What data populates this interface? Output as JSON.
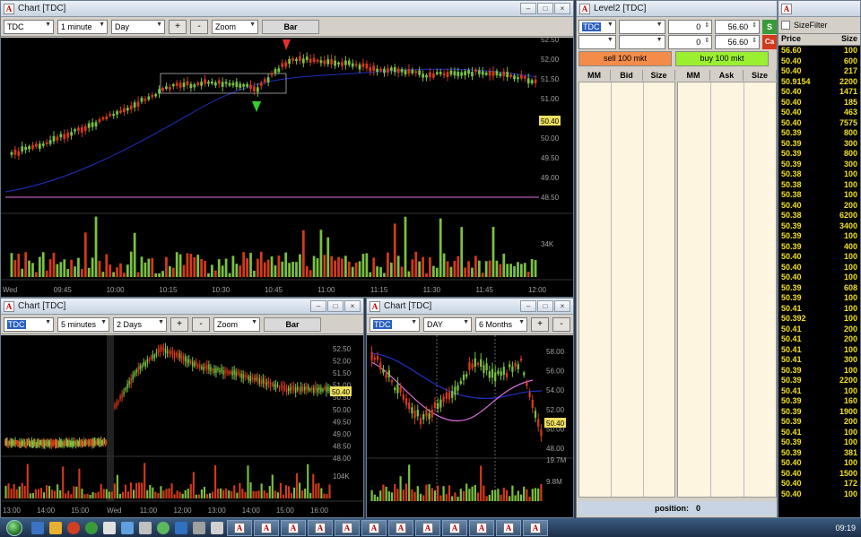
{
  "main_chart": {
    "title": "Chart [TDC]",
    "symbol": "TDC",
    "interval": "1 minute",
    "range": "Day",
    "plus_label": "+",
    "minus_label": "-",
    "zoom_label": "Zoom",
    "bar_label": "Bar",
    "price_ticks": [
      "52.50",
      "52.00",
      "51.50",
      "51.00",
      "50.50",
      "50.00",
      "49.50",
      "49.00",
      "48.50"
    ],
    "last_price": "50.40",
    "volume_label": "34K",
    "time_ticks": [
      "Wed",
      "09:45",
      "10:00",
      "10:15",
      "10:30",
      "10:45",
      "11:00",
      "11:15",
      "11:30",
      "11:45",
      "12:00"
    ]
  },
  "bl_chart": {
    "title": "Chart [TDC]",
    "symbol": "TDC",
    "interval": "5 minutes",
    "range": "2 Days",
    "plus_label": "+",
    "minus_label": "-",
    "zoom_label": "Zoom",
    "bar_label": "Bar",
    "price_ticks": [
      "52.50",
      "52.00",
      "51.50",
      "51.00",
      "50.50",
      "50.00",
      "49.50",
      "49.00",
      "48.50",
      "48.00"
    ],
    "last_price": "50.40",
    "volume_label": "104K",
    "time_ticks": [
      "13:00",
      "14:00",
      "15:00",
      "Wed",
      "11:00",
      "12:00",
      "13:00",
      "14:00",
      "15:00",
      "16:00"
    ]
  },
  "bm_chart": {
    "title": "Chart [TDC]",
    "symbol": "TDC",
    "interval": "DAY",
    "range": "6 Months",
    "plus_label": "+",
    "minus_label": "-",
    "price_ticks": [
      "58.00",
      "56.00",
      "54.00",
      "52.00",
      "50.00",
      "48.00"
    ],
    "last_price": "50.40",
    "volume_ticks": [
      "19.7M",
      "9.8M"
    ]
  },
  "level2": {
    "title": "Level2 [TDC]",
    "symbol": "TDC",
    "qty1": "0",
    "price1": "56.60",
    "qty2": "0",
    "price2": "56.60",
    "side_btn1": "S",
    "side_btn2": "Ca",
    "sell_label": "sell 100 mkt",
    "buy_label": "buy 100 mkt",
    "bid_headers": [
      "MM",
      "Bid",
      "Size"
    ],
    "ask_headers": [
      "MM",
      "Ask",
      "Size"
    ],
    "position_label": "position:",
    "position_value": "0"
  },
  "time_sales": {
    "title": "",
    "size_filter_label": "SizeFilter",
    "headers": [
      "Price",
      "Size"
    ],
    "rows": [
      [
        "56.60",
        "100"
      ],
      [
        "50.40",
        "600"
      ],
      [
        "50.40",
        "217"
      ],
      [
        "50.9154",
        "2200"
      ],
      [
        "50.40",
        "1471"
      ],
      [
        "50.40",
        "185"
      ],
      [
        "50.40",
        "463"
      ],
      [
        "50.40",
        "7575"
      ],
      [
        "50.39",
        "800"
      ],
      [
        "50.39",
        "300"
      ],
      [
        "50.39",
        "800"
      ],
      [
        "50.39",
        "300"
      ],
      [
        "50.38",
        "100"
      ],
      [
        "50.38",
        "100"
      ],
      [
        "50.38",
        "100"
      ],
      [
        "50.40",
        "200"
      ],
      [
        "50.38",
        "6200"
      ],
      [
        "50.39",
        "3400"
      ],
      [
        "50.39",
        "100"
      ],
      [
        "50.39",
        "400"
      ],
      [
        "50.40",
        "100"
      ],
      [
        "50.40",
        "100"
      ],
      [
        "50.40",
        "100"
      ],
      [
        "50.39",
        "608"
      ],
      [
        "50.39",
        "100"
      ],
      [
        "50.41",
        "100"
      ],
      [
        "50.392",
        "100"
      ],
      [
        "50.41",
        "200"
      ],
      [
        "50.41",
        "200"
      ],
      [
        "50.41",
        "100"
      ],
      [
        "50.41",
        "300"
      ],
      [
        "50.39",
        "100"
      ],
      [
        "50.39",
        "2200"
      ],
      [
        "50.41",
        "100"
      ],
      [
        "50.39",
        "160"
      ],
      [
        "50.39",
        "1900"
      ],
      [
        "50.39",
        "200"
      ],
      [
        "50.41",
        "100"
      ],
      [
        "50.39",
        "100"
      ],
      [
        "50.39",
        "381"
      ],
      [
        "50.40",
        "100"
      ],
      [
        "50.40",
        "1500"
      ],
      [
        "50.40",
        "172"
      ],
      [
        "50.40",
        "100"
      ]
    ]
  },
  "colors": {
    "up": "#7ac143",
    "down": "#d33a1a",
    "ma_blue": "#2030c0",
    "ma_pink": "#e070e0",
    "tick_text": "#a0a0a0",
    "price_tag": "#f0e060"
  },
  "taskbar": {
    "clock": "09:19"
  }
}
